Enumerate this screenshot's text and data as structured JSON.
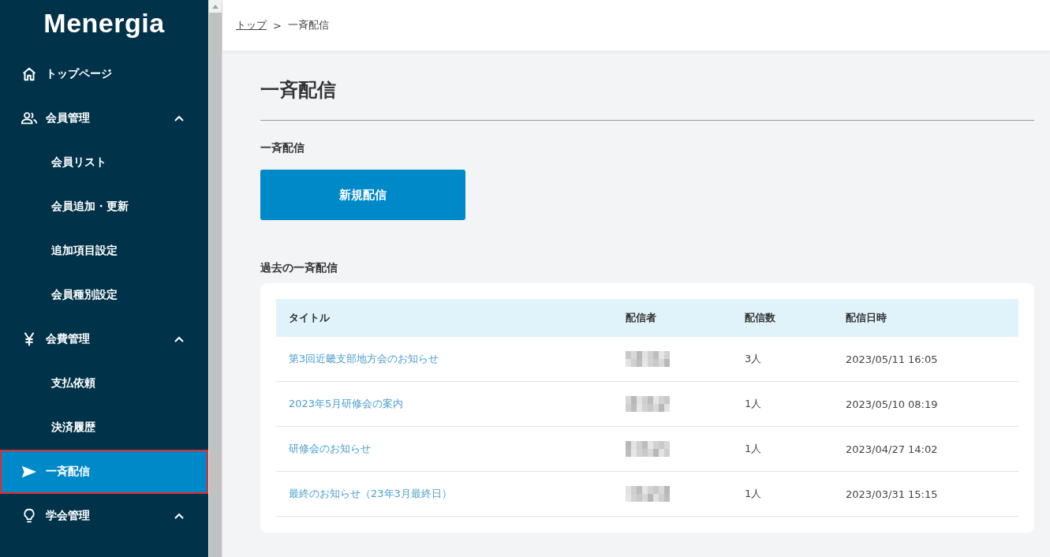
{
  "sidebar": {
    "logo": "Menergia",
    "items": [
      {
        "label": "トップページ",
        "selected": false
      },
      {
        "label": "会員管理",
        "selected": false,
        "expanded": true,
        "children": [
          {
            "label": "会員リスト",
            "selected": false
          },
          {
            "label": "会員追加・更新",
            "selected": false
          },
          {
            "label": "追加項目設定",
            "selected": false
          },
          {
            "label": "会員種別設定",
            "selected": false
          }
        ]
      },
      {
        "label": "会費管理",
        "selected": false,
        "expanded": true,
        "children": [
          {
            "label": "支払依頼",
            "selected": false
          },
          {
            "label": "決済履歴",
            "selected": false
          }
        ]
      },
      {
        "label": "一斉配信",
        "selected": true
      },
      {
        "label": "学会管理",
        "selected": false,
        "expanded": true
      }
    ]
  },
  "breadcrumb": [
    {
      "label": "トップ",
      "kind": "link"
    },
    {
      "label": ">",
      "kind": "separator"
    },
    {
      "label": "一斉配信",
      "kind": "current"
    }
  ],
  "page_title": "一斉配信",
  "section_label": "一斉配信",
  "new_button": "新規配信",
  "history_label": "過去の一斉配信",
  "table": {
    "columns": [
      "タイトル",
      "配信者",
      "配信数",
      "配信日時"
    ],
    "rows": [
      {
        "title": "第3回近畿支部地方会のお知らせ",
        "sender_redacted": true,
        "count": "3人",
        "date": "2023/05/11 16:05"
      },
      {
        "title": "2023年5月研修会の案内",
        "sender_redacted": true,
        "count": "1人",
        "date": "2023/05/10 08:19"
      },
      {
        "title": "研修会のお知らせ",
        "sender_redacted": true,
        "count": "1人",
        "date": "2023/04/27 14:02"
      },
      {
        "title": "最終のお知らせ（23年3月最終日）",
        "sender_redacted": true,
        "count": "1人",
        "date": "2023/03/31 15:15"
      }
    ]
  }
}
